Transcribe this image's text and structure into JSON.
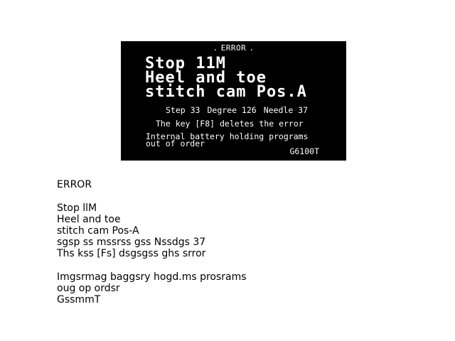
{
  "display": {
    "title": "ERROR",
    "title_dot_left": ".",
    "title_dot_right": ".",
    "main_lines": [
      "Stop 11M",
      "Heel and toe",
      "stitch cam Pos.A"
    ],
    "step": "Step 33",
    "degree": "Degree 126",
    "needle": "Needle 37",
    "f8_message": "The key [F8] deletes the error",
    "battery_line1": "Internal battery holding programs",
    "battery_line2": "out of order",
    "code": "G6100T"
  },
  "transcript": {
    "header": "ERROR",
    "lines_a": [
      "Stop llM",
      "Heel and toe",
      "stitch cam Pos-A",
      "sgsp ss mssrss gss Nssdgs 37",
      "Ths kss [Fs] dsgsgss ghs srror"
    ],
    "lines_b": [
      "Imgsrmag baggsry hogd.ms prosrams",
      "oug op ordsr",
      "GssmmT"
    ]
  }
}
